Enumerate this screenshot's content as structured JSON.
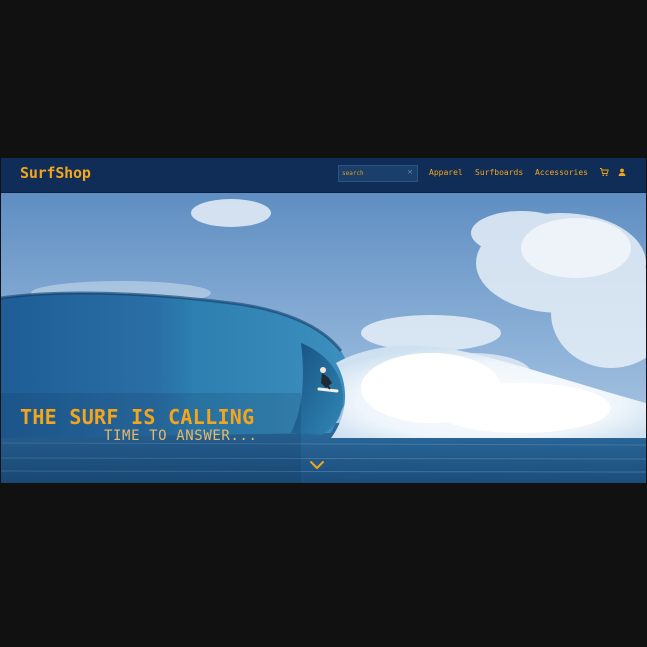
{
  "header": {
    "brand": "SurfShop",
    "search": {
      "value": "",
      "placeholder": "search",
      "clear_glyph": "×"
    },
    "nav": [
      {
        "label": "Apparel"
      },
      {
        "label": "Surfboards"
      },
      {
        "label": "Accessories"
      }
    ],
    "icons": [
      "cart-icon",
      "user-icon"
    ]
  },
  "hero": {
    "headline": "THE SURF IS CALLING",
    "subline": "TIME TO ANSWER...",
    "scroll_icon": "chevron-down-icon"
  },
  "colors": {
    "navbar_bg": "#0f2d56",
    "accent": "#f4a51c",
    "page_bg": "#111111"
  }
}
